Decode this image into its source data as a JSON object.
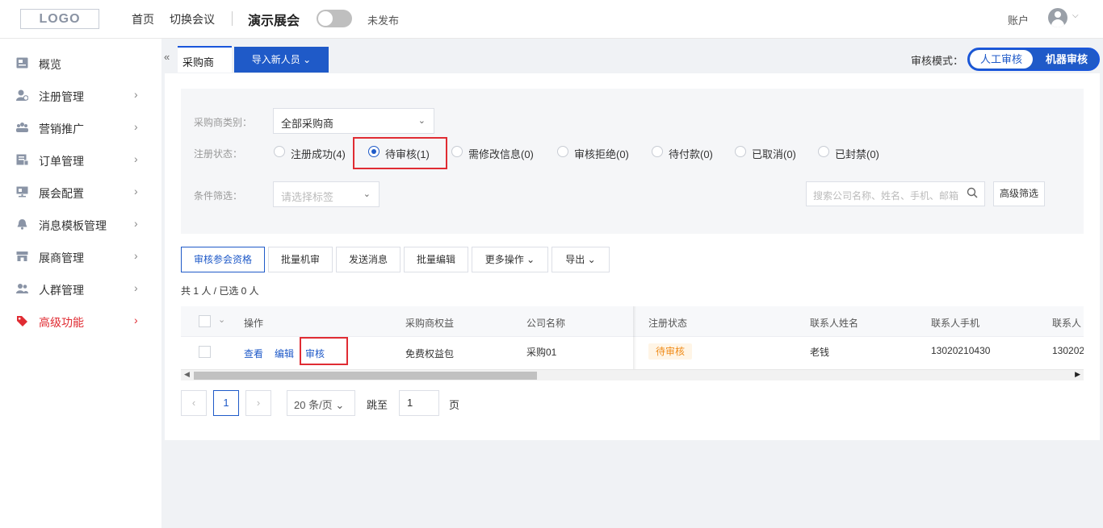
{
  "header": {
    "logo": "LOGO",
    "nav": [
      "首页",
      "切换会议"
    ],
    "event_title": "演示展会",
    "publish_status": "未发布",
    "account": "账户"
  },
  "sidebar": {
    "items": [
      {
        "label": "概览",
        "icon": "overview-icon"
      },
      {
        "label": "注册管理",
        "icon": "user-register-icon"
      },
      {
        "label": "营销推广",
        "icon": "group-icon"
      },
      {
        "label": "订单管理",
        "icon": "order-icon"
      },
      {
        "label": "展会配置",
        "icon": "monitor-icon"
      },
      {
        "label": "消息模板管理",
        "icon": "bell-icon"
      },
      {
        "label": "展商管理",
        "icon": "store-icon"
      },
      {
        "label": "人群管理",
        "icon": "people-icon"
      },
      {
        "label": "高级功能",
        "icon": "tag-icon"
      }
    ],
    "active_color": "#e02c33"
  },
  "tabs": {
    "collapse": "«",
    "active": "采购商",
    "import_button": "导入新人员"
  },
  "review_mode": {
    "label": "审核模式：",
    "manual": "人工审核",
    "machine": "机器审核"
  },
  "filters": {
    "buyer_type_label": "采购商类别：",
    "buyer_type_value": "全部采购商",
    "status_label": "注册状态：",
    "statuses": [
      "注册成功(4)",
      "待审核(1)",
      "需修改信息(0)",
      "审核拒绝(0)",
      "待付款(0)",
      "已取消(0)",
      "已封禁(0)"
    ],
    "selected_status": "待审核(1)",
    "condition_label": "条件筛选：",
    "condition_placeholder": "请选择标签",
    "search_placeholder": "搜索公司名称、姓名、手机、邮箱",
    "advanced": "高级筛选"
  },
  "actions": [
    "审核参会资格",
    "批量机审",
    "发送消息",
    "批量编辑",
    "更多操作",
    "导出"
  ],
  "count_text": "共 1 人 / 已选 0 人",
  "table": {
    "columns": [
      "操作",
      "采购商权益",
      "公司名称",
      "注册状态",
      "联系人姓名",
      "联系人手机",
      "联系人"
    ],
    "row": {
      "view": "查看",
      "edit": "编辑",
      "review": "审核",
      "benefit": "免费权益包",
      "company": "采购01",
      "status": "待审核",
      "contact_name": "老钱",
      "contact_phone": "13020210430",
      "contact_extra": "130202"
    }
  },
  "pagination": {
    "prev": "‹",
    "current": "1",
    "next": "›",
    "page_size": "20 条/页",
    "goto_label": "跳至",
    "goto_value": "1",
    "page_suffix": "页"
  },
  "colors": {
    "primary": "#1f5ac8",
    "highlight": "#e02c33",
    "pending_tag": "#f08c1a"
  }
}
